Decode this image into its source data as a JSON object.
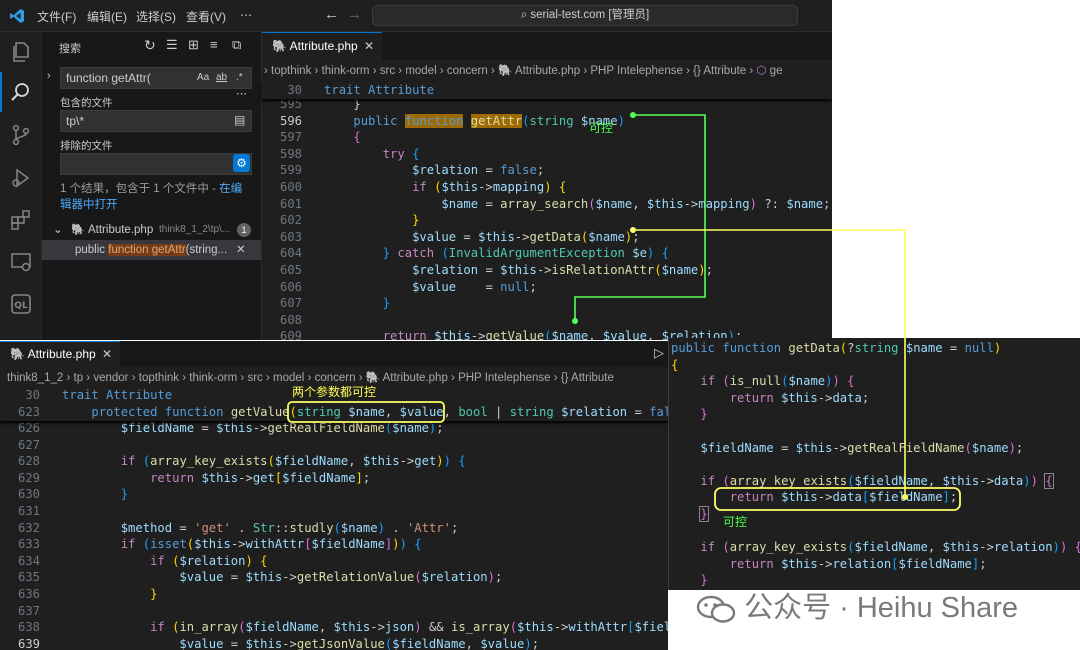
{
  "window1": {
    "menu": [
      "文件(F)",
      "编辑(E)",
      "选择(S)",
      "查看(V)",
      "⋯"
    ],
    "command_center": "serial-test.com [管理员]",
    "sidebar": {
      "title": "搜索",
      "search_value": "function getAttr(",
      "search_toggles": [
        "Aa",
        "ab",
        ".*"
      ],
      "include_label": "包含的文件",
      "include_value": "tp\\*",
      "exclude_label": "排除的文件",
      "exclude_value": "",
      "result_text": "1 个结果，包含于 1 个文件中 - ",
      "result_link_1": "在编",
      "result_link_2": "辑器中打开",
      "file_name": "Attribute.php",
      "file_path": "think8_1_2\\tp\\...",
      "file_count": "1",
      "match_pre": "public ",
      "match_hit": "function getAttr",
      "match_post": "(string..."
    },
    "tab_label": "Attribute.php",
    "breadcrumb": [
      "topthink",
      "think-orm",
      "src",
      "model",
      "concern",
      "Attribute.php",
      "PHP Intelephense",
      "{} Attribute",
      "ge"
    ],
    "sticky": {
      "ln": "30",
      "code": "trait Attribute"
    },
    "annotation": "可控"
  },
  "window2": {
    "tab_label": "Attribute.php",
    "breadcrumb": [
      "think8_1_2",
      "tp",
      "vendor",
      "topthink",
      "think-orm",
      "src",
      "model",
      "concern",
      "Attribute.php",
      "PHP Intelephense",
      "{} Attribute"
    ],
    "sticky_1": {
      "ln": "30",
      "code": "trait Attribute"
    },
    "annotation": "两个参数都可控"
  },
  "window3": {
    "annotation": "可控"
  },
  "watermark": "公众号 · Heihu Share"
}
